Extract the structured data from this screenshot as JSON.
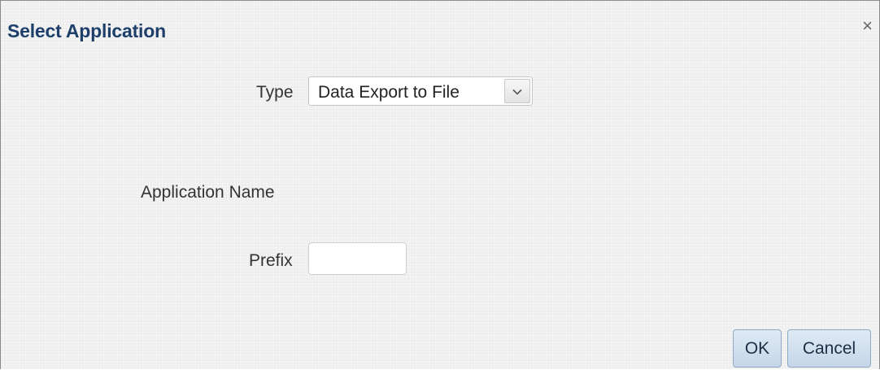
{
  "dialog": {
    "title": "Select Application",
    "close_glyph": "×"
  },
  "form": {
    "type_label": "Type",
    "type_value": "Data Export to File",
    "application_name_label": "Application Name",
    "prefix_label": "Prefix",
    "prefix_value": "",
    "prefix_placeholder": ""
  },
  "buttons": {
    "ok_label": "OK",
    "cancel_label": "Cancel"
  },
  "icons": {
    "close": "close-icon",
    "dropdown": "chevron-down-icon"
  },
  "colors": {
    "title": "#1d3f6a",
    "button_bg": "#d3e1ef",
    "button_border": "#8ea9c4"
  }
}
